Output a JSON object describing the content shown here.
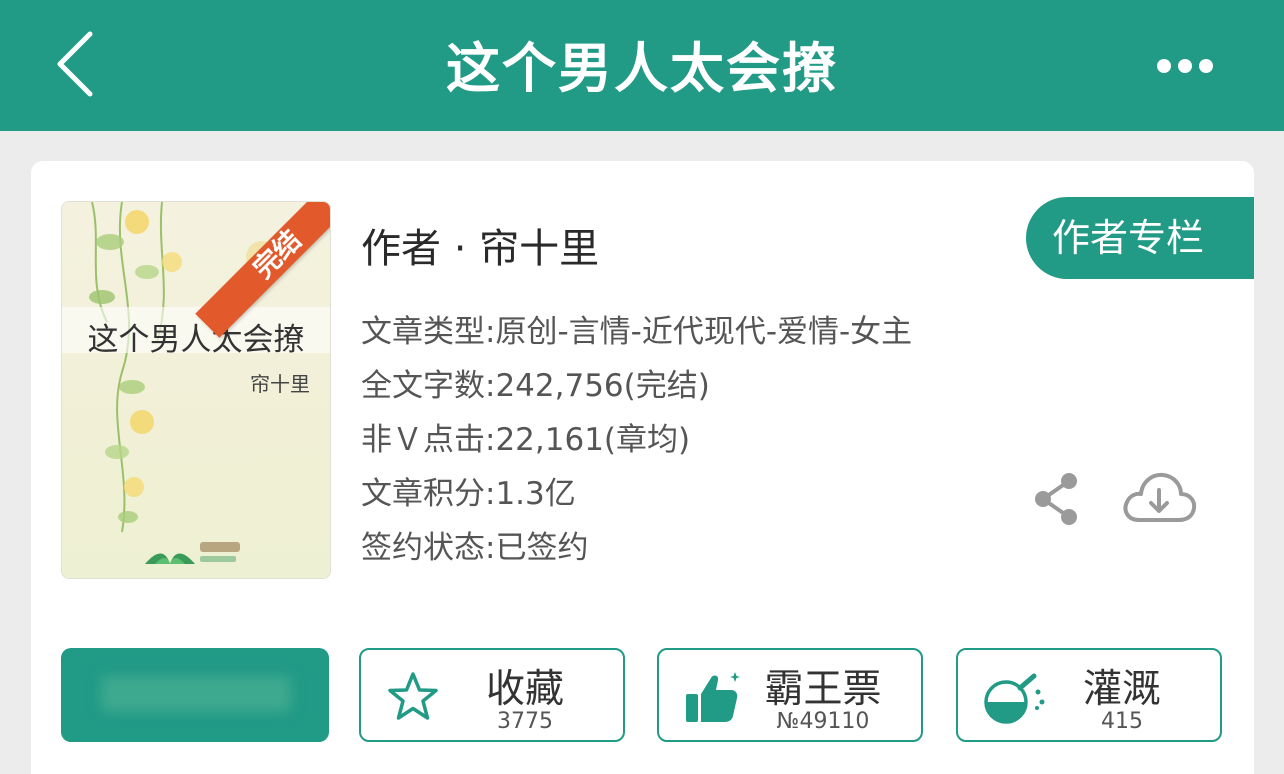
{
  "header": {
    "title": "这个男人太会撩",
    "back_icon": "chevron-left-icon",
    "more_icon": "more-horizontal-icon"
  },
  "book": {
    "cover": {
      "title": "这个男人太会撩",
      "author": "帘十里",
      "ribbon": "完结"
    },
    "author_line": "作者 · 帘十里",
    "author_column_button": "作者专栏",
    "info": [
      "文章类型:原创-言情-近代现代-爱情-女主",
      "全文字数:242,756(完结)",
      "非Ｖ点击:22,161(章均)",
      "文章积分:1.3亿",
      "签约状态:已签约"
    ]
  },
  "actions": {
    "favorite": {
      "label": "收藏",
      "count": "3775",
      "icon": "star-icon"
    },
    "overlord_ticket": {
      "label": "霸王票",
      "count": "№49110",
      "icon": "thumbs-up-icon"
    },
    "irrigate": {
      "label": "灌溉",
      "count": "415",
      "icon": "watering-flask-icon"
    }
  },
  "colors": {
    "accent": "#219a86",
    "ribbon": "#e25a2b"
  }
}
